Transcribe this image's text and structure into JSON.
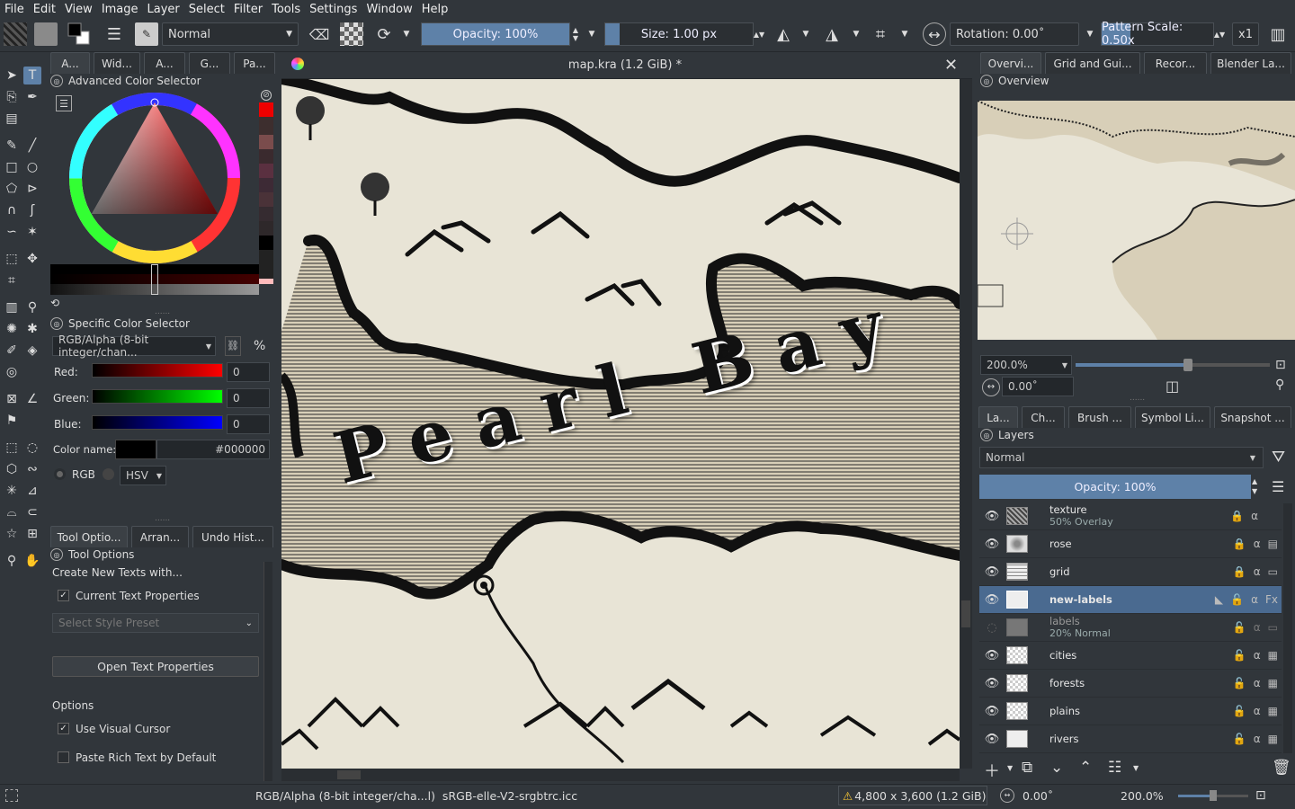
{
  "menu": [
    "File",
    "Edit",
    "View",
    "Image",
    "Layer",
    "Select",
    "Filter",
    "Tools",
    "Settings",
    "Window",
    "Help"
  ],
  "toolbar": {
    "blend_mode": "Normal",
    "opacity": "Opacity: 100%",
    "size": "Size: 1.00 px",
    "rotation": "Rotation: 0.00˚",
    "pattern_scale": "Pattern Scale: 0.50x",
    "multiplier": "x1"
  },
  "left_tabs": [
    "A...",
    "Wid...",
    "A...",
    "G...",
    "Pa..."
  ],
  "color_selector": {
    "title": "Advanced Color Selector",
    "specific_title": "Specific Color Selector",
    "color_model": "RGB/Alpha (8-bit integer/chan...",
    "percent": "%",
    "red_label": "Red:",
    "red_value": "0",
    "green_label": "Green:",
    "green_value": "0",
    "blue_label": "Blue:",
    "blue_value": "0",
    "color_name_label": "Color name:",
    "hex": "#000000",
    "rgb": "RGB",
    "hsv": "HSV"
  },
  "tool_tabs": [
    "Tool Optio...",
    "Arran...",
    "Undo Hist..."
  ],
  "tool_options": {
    "title": "Tool Options",
    "create_label": "Create New Texts with...",
    "current_text_props": "Current Text Properties",
    "style_preset": "Select Style Preset",
    "open_text_props": "Open Text Properties",
    "options_label": "Options",
    "use_visual_cursor": "Use Visual Cursor",
    "paste_rich_text": "Paste Rich Text by Default"
  },
  "document": {
    "title": "map.kra (1.2 GiB) *",
    "map_label": "Pearl Bay"
  },
  "right_tabs_top": [
    "Overvi...",
    "Grid and Gui...",
    "Recor...",
    "Blender La..."
  ],
  "overview": {
    "title": "Overview",
    "zoom": "200.0%",
    "rotation": "0.00˚",
    "zoom_fraction": 0.58
  },
  "right_tabs_bottom": [
    "La...",
    "Ch...",
    "Brush ...",
    "Symbol Li...",
    "Snapshot ..."
  ],
  "layers": {
    "title": "Layers",
    "blend_mode": "Normal",
    "opacity": "Opacity: 100%",
    "items": [
      {
        "name": "texture",
        "sub": "50% Overlay",
        "visible": true
      },
      {
        "name": "rose",
        "sub": "",
        "visible": true
      },
      {
        "name": "grid",
        "sub": "",
        "visible": true
      },
      {
        "name": "new-labels",
        "sub": "",
        "visible": true
      },
      {
        "name": "labels",
        "sub": "20% Normal",
        "visible": false
      },
      {
        "name": "cities",
        "sub": "",
        "visible": true
      },
      {
        "name": "forests",
        "sub": "",
        "visible": true
      },
      {
        "name": "plains",
        "sub": "",
        "visible": true
      },
      {
        "name": "rivers",
        "sub": "",
        "visible": true
      }
    ]
  },
  "status": {
    "color_profile": "RGB/Alpha (8-bit integer/cha...l)  sRGB-elle-V2-srgbtrc.icc",
    "dimensions": "4,800 x 3,600 (1.2 GiB)",
    "rotation": "0.00˚",
    "zoom": "200.0%",
    "zoom_fraction": 0.5
  },
  "colors": {
    "accent": "#5e81a8",
    "paper": "#e8e4d6",
    "land": "#d8cfb8",
    "ink": "#111111"
  }
}
